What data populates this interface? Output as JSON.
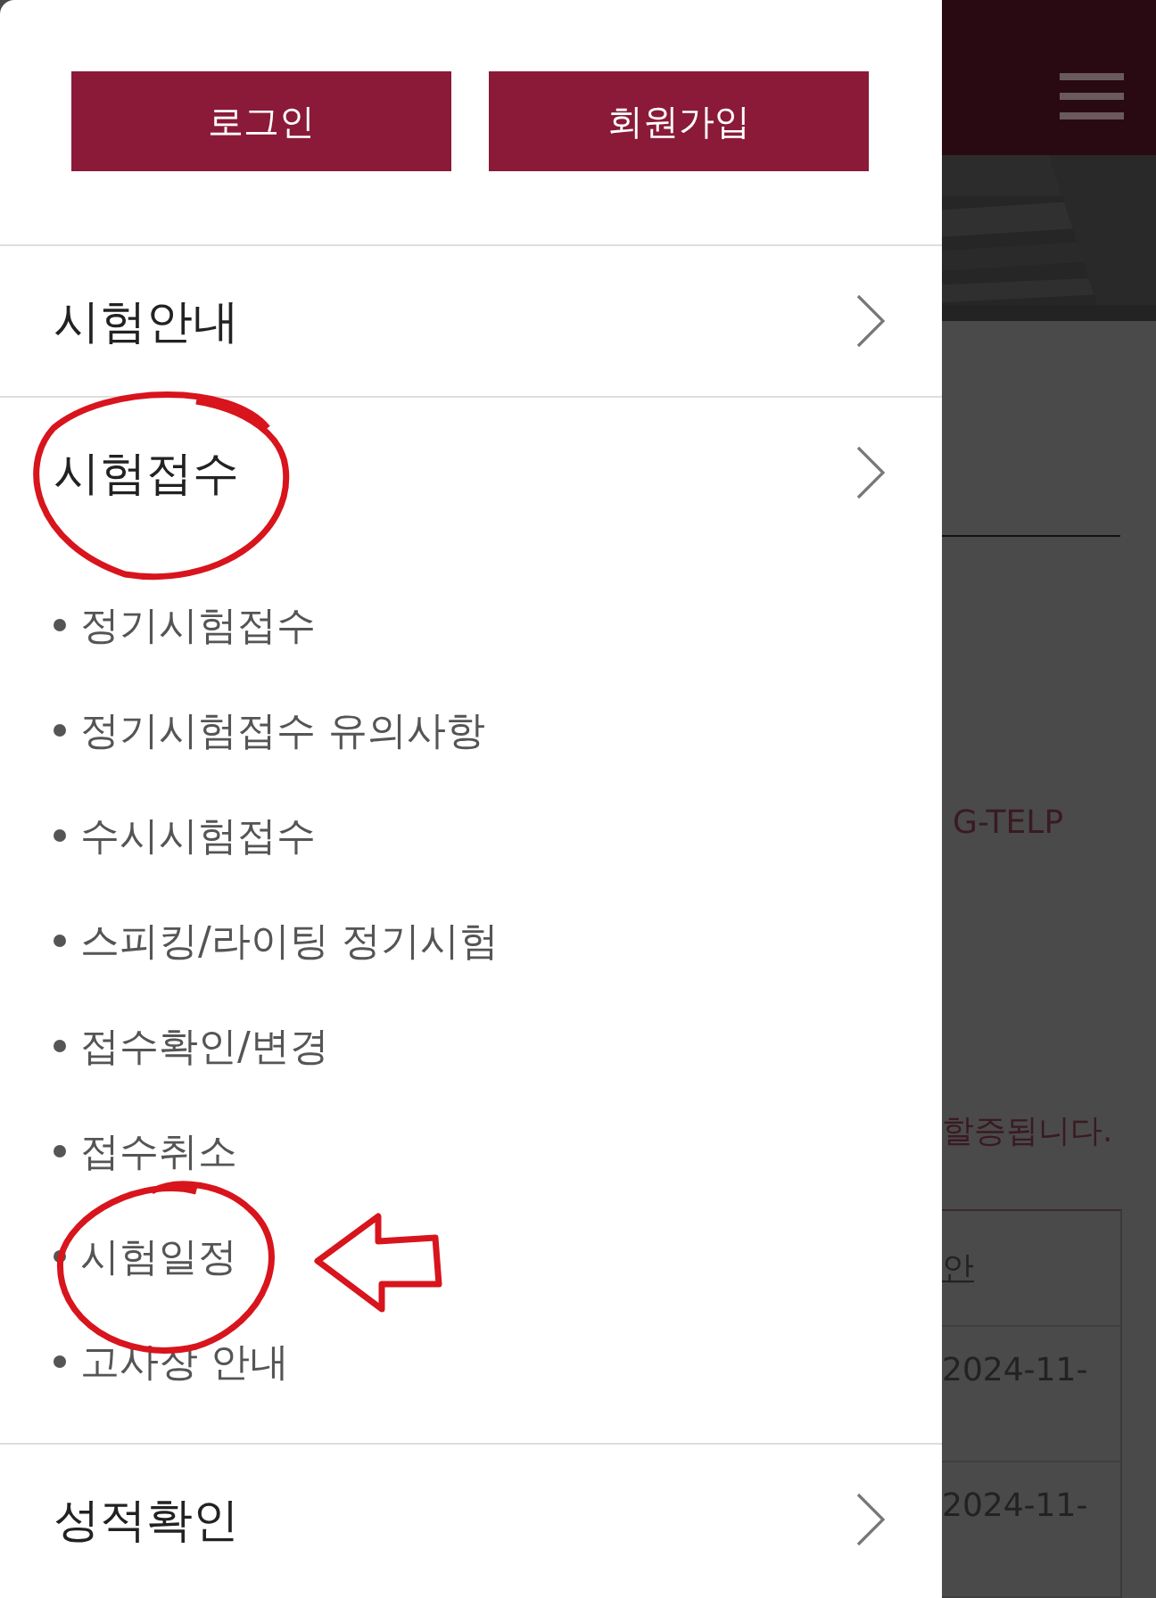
{
  "drawer": {
    "buttons": [
      "로그인",
      "회원가입"
    ],
    "menu": [
      {
        "label": "시험안내"
      },
      {
        "label": "시험접수",
        "children": [
          "정기시험접수",
          "정기시험접수 유의사항",
          "수시시험접수",
          "스피킹/라이팅 정기시험",
          "접수확인/변경",
          "접수취소",
          "시험일정",
          "고사장 안내"
        ]
      },
      {
        "label": "성적확인"
      }
    ]
  },
  "background_page": {
    "text_fragment": "G-TELP",
    "notice_fragment": "할증됩니다.",
    "table": {
      "header": "안",
      "rows": [
        "2024-11-",
        "2024-11-"
      ]
    }
  }
}
